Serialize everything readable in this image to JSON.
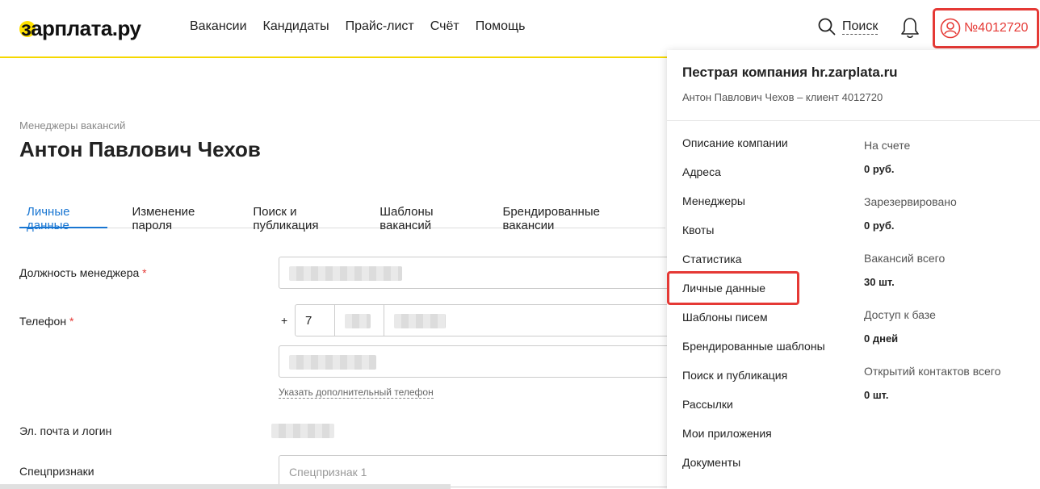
{
  "header": {
    "logo": "зарплата.ру",
    "nav": [
      "Вакансии",
      "Кандидаты",
      "Прайс-лист",
      "Счёт",
      "Помощь"
    ],
    "search_label": "Поиск",
    "account_number": "№4012720"
  },
  "page": {
    "breadcrumb": "Менеджеры вакансий",
    "title": "Антон Павлович Чехов",
    "tabs": [
      "Личные данные",
      "Изменение пароля",
      "Поиск и публикация",
      "Шаблоны вакансий",
      "Брендированные вакансии"
    ]
  },
  "form": {
    "position_label": "Должность менеджера",
    "phone_label": "Телефон",
    "required_mark": "*",
    "plus": "+",
    "country_code": "7",
    "add_phone_link": "Указать дополнительный телефон",
    "email_label": "Эл. почта и логин",
    "special_label": "Спецпризнаки",
    "special_placeholder": "Спецпризнак 1"
  },
  "dropdown": {
    "company": "Пестрая компания hr.zarplata.ru",
    "client": "Антон Павлович Чехов – клиент 4012720",
    "menu": [
      "Описание компании",
      "Адреса",
      "Менеджеры",
      "Квоты",
      "Статистика",
      "Личные данные",
      "Шаблоны писем",
      "Брендированные шаблоны",
      "Поиск и публикация",
      "Рассылки",
      "Мои приложения",
      "Документы"
    ],
    "stats": [
      {
        "label": "На счете",
        "value": "0 руб."
      },
      {
        "label": "Зарезервировано",
        "value": "0 руб."
      },
      {
        "label": "Вакансий всего",
        "value": "30 шт."
      },
      {
        "label": "Доступ к базе",
        "value": "0 дней"
      },
      {
        "label": "Открытий контактов всего",
        "value": "0 шт."
      }
    ]
  },
  "colors": {
    "accent": "#1976d2",
    "brand_yellow": "#ffe000",
    "highlight_red": "#e53935"
  }
}
